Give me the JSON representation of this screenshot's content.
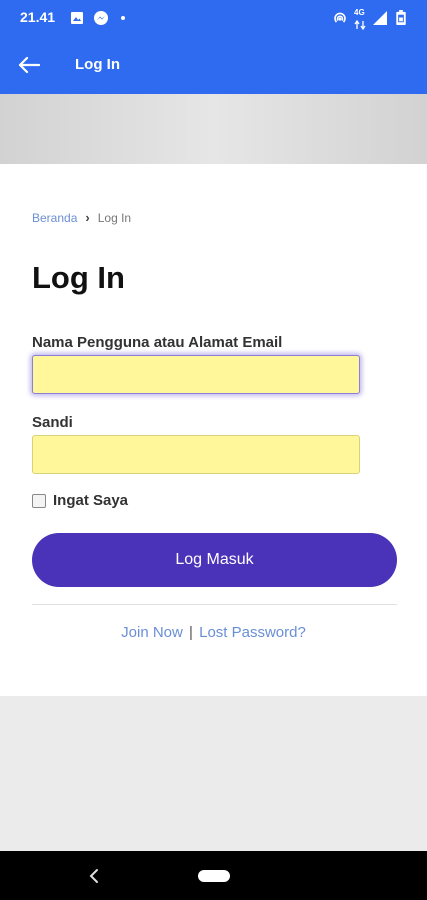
{
  "status_bar": {
    "time": "21.41",
    "network_label": "4G",
    "icons": [
      "image-icon",
      "messenger-icon",
      "dot-icon",
      "hotspot-icon",
      "data-arrows-icon",
      "signal-icon",
      "battery-icon"
    ]
  },
  "app_bar": {
    "title": "Log In",
    "back_icon": "arrow-left-icon"
  },
  "breadcrumb": {
    "home": "Beranda",
    "current": "Log In"
  },
  "page_title": "Log In",
  "form": {
    "username_label": "Nama Pengguna atau Alamat Email",
    "username_value": "",
    "password_label": "Sandi",
    "password_value": "",
    "remember_label": "Ingat Saya",
    "remember_checked": false,
    "submit_label": "Log Masuk"
  },
  "links": {
    "join": "Join Now",
    "separator": "|",
    "lost_password": "Lost Password?"
  },
  "colors": {
    "app_bar": "#2e6bf0",
    "button": "#4a33b8",
    "input_fill": "#fff799",
    "link": "#6a8ed6"
  }
}
